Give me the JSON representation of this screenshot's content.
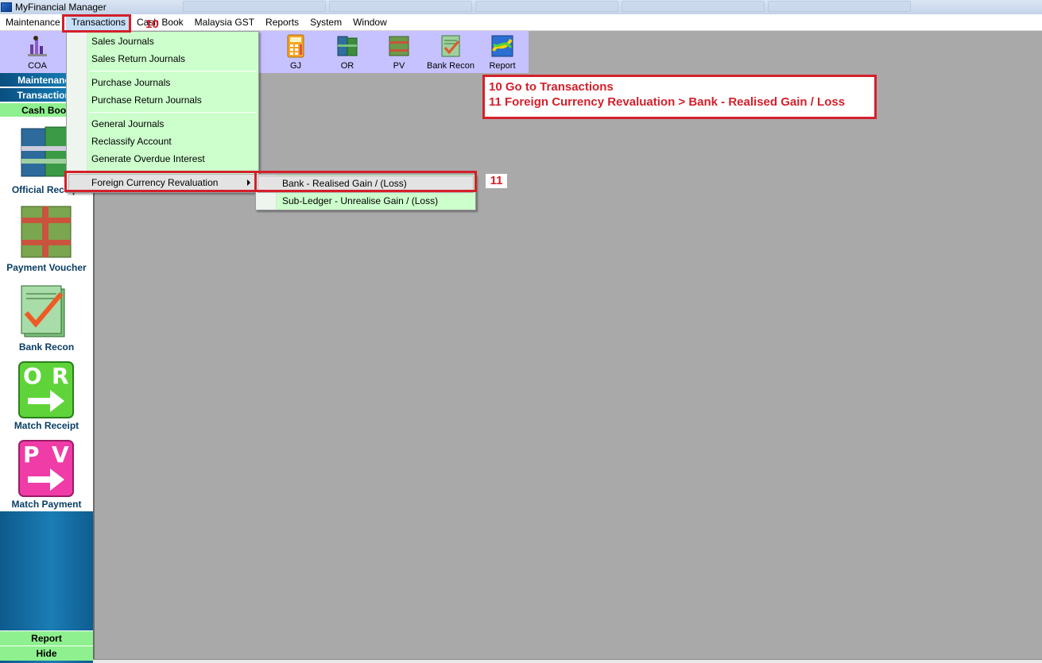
{
  "window": {
    "title": "MyFinancial Manager"
  },
  "menubar": {
    "items": [
      {
        "label": "Maintenance"
      },
      {
        "label": "Transactions"
      },
      {
        "label": "Cash Book"
      },
      {
        "label": "Malaysia GST"
      },
      {
        "label": "Reports"
      },
      {
        "label": "System"
      },
      {
        "label": "Window"
      }
    ]
  },
  "toolbar": {
    "buttons": [
      {
        "label": "COA",
        "icon": "chart-of-accounts-icon"
      },
      {
        "label": "GJ",
        "icon": "calculator-icon"
      },
      {
        "label": "OR",
        "icon": "money-stack-icon"
      },
      {
        "label": "PV",
        "icon": "payment-voucher-icon"
      },
      {
        "label": "Bank Recon",
        "icon": "checkmark-document-icon"
      },
      {
        "label": "Report",
        "icon": "report-chart-icon"
      }
    ]
  },
  "sidebar": {
    "headers": [
      {
        "label": "Maintenance"
      },
      {
        "label": "Transactions"
      },
      {
        "label": "Cash Book"
      }
    ],
    "items": [
      {
        "label": "Official Receipt",
        "icon": "money-stack-icon"
      },
      {
        "label": "Payment Voucher",
        "icon": "money-bundle-icon"
      },
      {
        "label": "Bank Recon",
        "icon": "checkmark-document-icon"
      },
      {
        "label": "Match Receipt",
        "icon": "or-arrow-icon"
      },
      {
        "label": "Match Payment",
        "icon": "pv-arrow-icon"
      }
    ],
    "bottom": [
      {
        "label": "Report"
      },
      {
        "label": "Hide"
      }
    ]
  },
  "transactions_menu": {
    "items": [
      {
        "label": "Sales Journals"
      },
      {
        "label": "Sales Return Journals"
      },
      {
        "label": "Purchase Journals"
      },
      {
        "label": "Purchase Return Journals"
      },
      {
        "label": "General Journals"
      },
      {
        "label": "Reclassify Account"
      },
      {
        "label": "Generate Overdue Interest"
      },
      {
        "label": "Foreign Currency Revaluation"
      }
    ]
  },
  "submenu": {
    "items": [
      {
        "label": "Bank - Realised Gain / (Loss)"
      },
      {
        "label": "Sub-Ledger - Unrealise Gain / (Loss)"
      }
    ]
  },
  "annotations": {
    "step10": "10",
    "step11": "11",
    "note_line1": "10 Go to Transactions",
    "note_line2": "11 Foreign Currency Revaluation > Bank - Realised Gain / Loss"
  },
  "colors": {
    "toolbar_bg": "#c6c2ff",
    "menu_bg": "#ccffcc",
    "annotation_red": "#d3202b",
    "sidebar_blue": "#1b7db5",
    "sidebar_green": "#8ef08e"
  }
}
